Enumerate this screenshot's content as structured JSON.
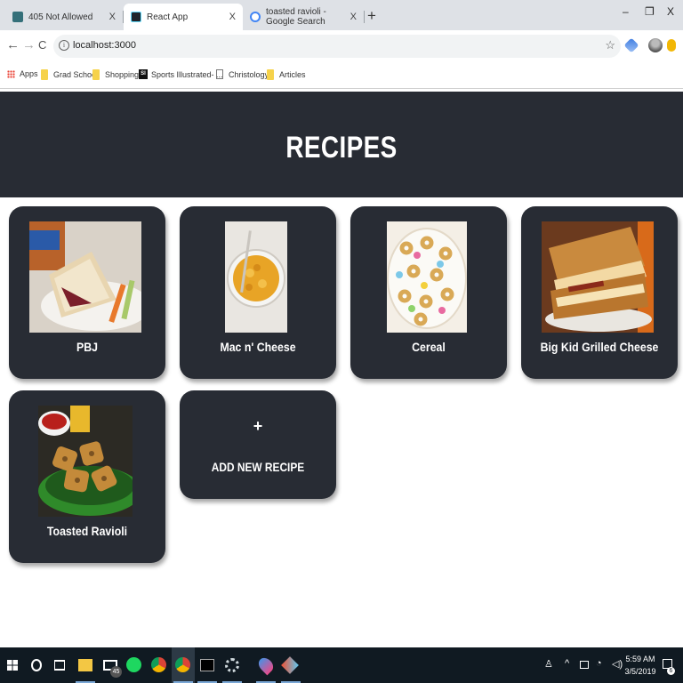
{
  "browser": {
    "tabs": [
      {
        "title": "405 Not Allowed",
        "close": "X"
      },
      {
        "title": "React App",
        "close": "X"
      },
      {
        "title": "toasted ravioli - Google Search",
        "close": "X"
      }
    ],
    "new_tab": "+",
    "window": {
      "minimize": "–",
      "maximize": "❐",
      "close": "X"
    },
    "nav": {
      "back": "←",
      "forward": "→",
      "reload": "C"
    },
    "url": "localhost:3000",
    "info": "i",
    "star": "☆",
    "bookmarks": [
      "Apps",
      "Grad School",
      "Shopping",
      "Sports Illustrated- ...",
      "Christology",
      "Articles"
    ],
    "si_badge": "SI"
  },
  "page": {
    "title": "RECIPES",
    "recipes": [
      {
        "name": "PBJ"
      },
      {
        "name": "Mac n' Cheese"
      },
      {
        "name": "Cereal"
      },
      {
        "name": "Big Kid Grilled Cheese"
      },
      {
        "name": "Toasted Ravioli"
      }
    ],
    "add_card": {
      "plus": "+",
      "label": "ADD NEW RECIPE"
    }
  },
  "taskbar": {
    "mail_badge": "45",
    "time": "5:59 AM",
    "date": "3/5/2019",
    "notif_badge": "6"
  },
  "colors": {
    "header_bg": "#282c34",
    "card_bg": "#282c34",
    "text": "#ffffff"
  }
}
